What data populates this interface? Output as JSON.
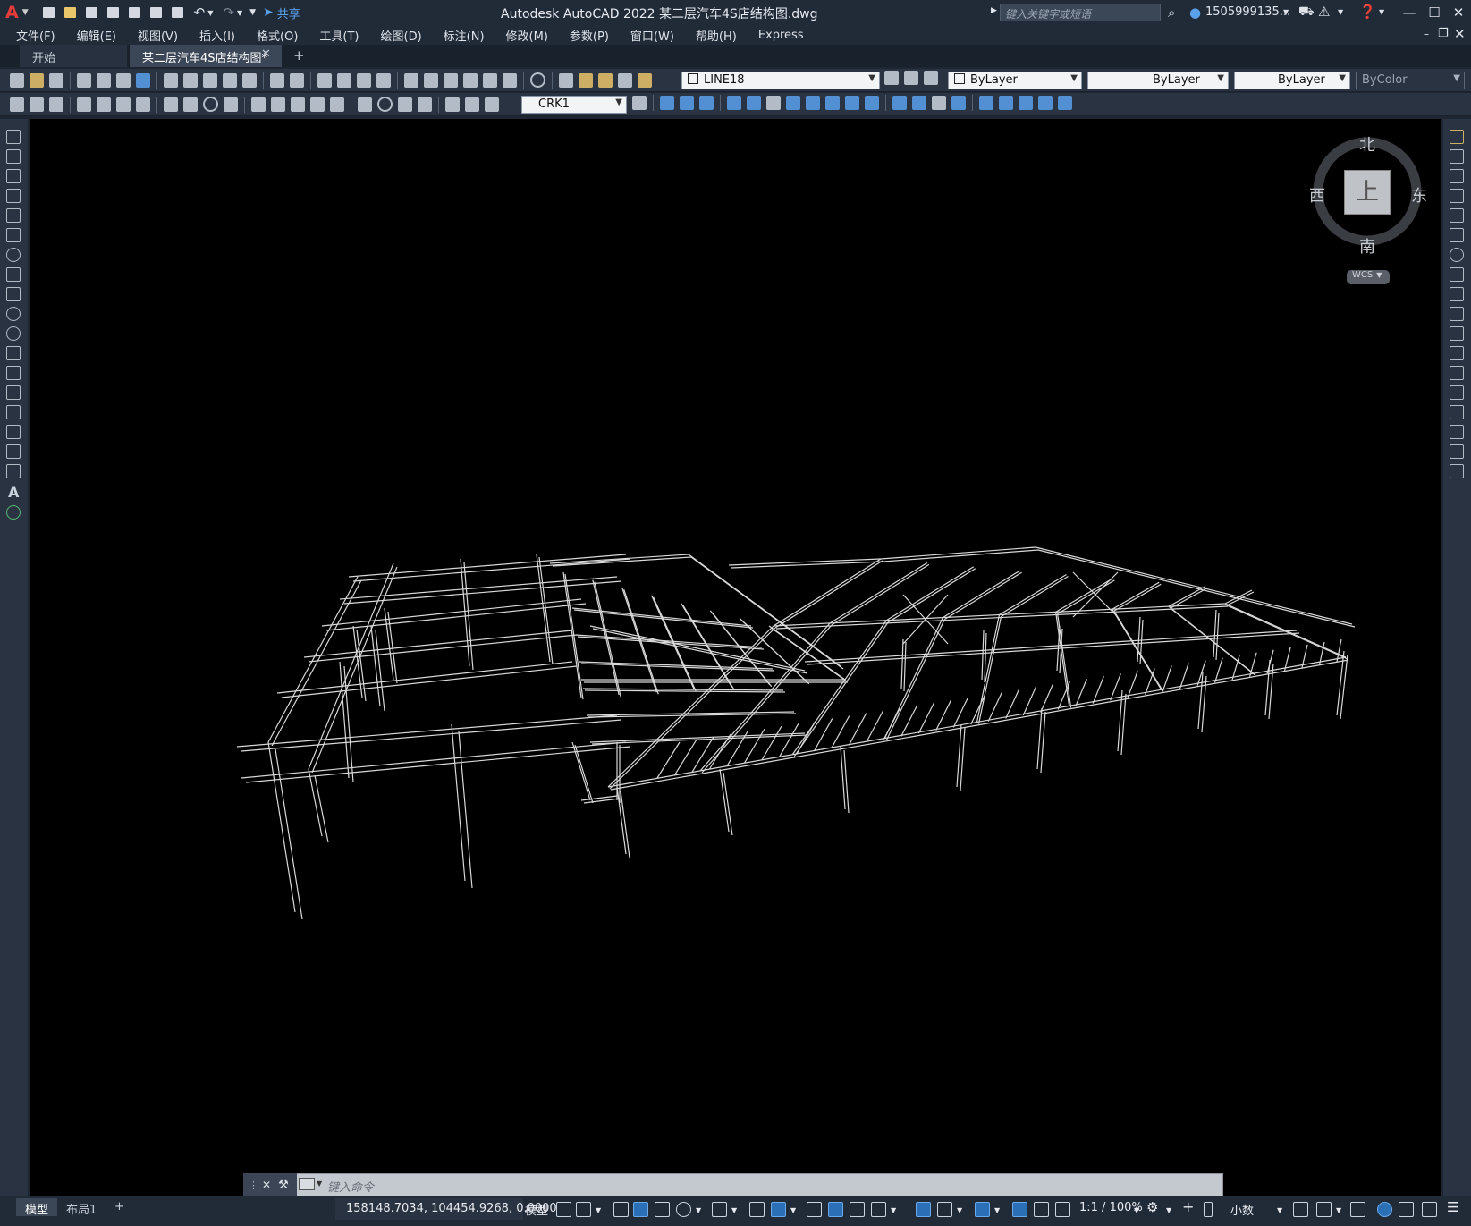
{
  "app": {
    "title": "Autodesk AutoCAD 2022    某二层汽车4S店结构图.dwg",
    "search_placeholder": "键入关键字或短语",
    "user": "1505999135...",
    "share_label": "共享",
    "logo": "A"
  },
  "menu": [
    "文件(F)",
    "编辑(E)",
    "视图(V)",
    "插入(I)",
    "格式(O)",
    "工具(T)",
    "绘图(D)",
    "标注(N)",
    "修改(M)",
    "参数(P)",
    "窗口(W)",
    "帮助(H)",
    "Express"
  ],
  "tabs": {
    "start": "开始",
    "document": "某二层汽车4S店结构图*",
    "close": "✕",
    "add": "+"
  },
  "toolbar": {
    "layer": "LINE18",
    "color": "ByLayer",
    "linetype": "ByLayer",
    "lineweight": "ByLayer",
    "plotstyle": "ByColor",
    "dimstyle": "CRK1"
  },
  "viewcube": {
    "north": "北",
    "south": "南",
    "east": "东",
    "west": "西",
    "face": "上",
    "wcs": "WCS"
  },
  "command": {
    "placeholder": "键入命令",
    "close": "✕"
  },
  "layout_tabs": {
    "model": "模型",
    "layout1": "布局1",
    "add": "+"
  },
  "status": {
    "coords": "158148.7034, 104454.9268, 0.0000",
    "mode": "模型",
    "scale": "1:1 / 100%",
    "units": "小数"
  },
  "colors": {
    "viewport_bg": "#000000",
    "wire": "#d9d9d9",
    "accent": "#2b6fb7"
  }
}
